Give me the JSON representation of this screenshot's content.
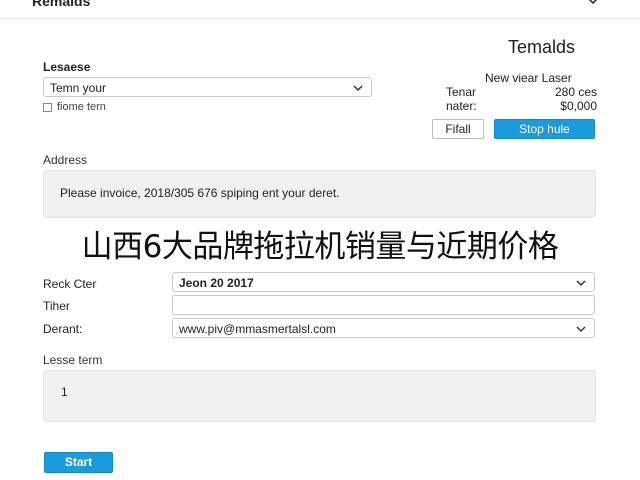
{
  "header": {
    "title": "Remalds"
  },
  "panel_title": "Temalds",
  "lease": {
    "label": "Lesaese",
    "select_value": "Temn your",
    "checkbox_label": "fiome tern"
  },
  "summary": {
    "heading": "New viear Laser",
    "rows": [
      {
        "key": "Tenar",
        "value": "280 ces"
      },
      {
        "key": "nater:",
        "value": "$0,000"
      }
    ],
    "fill_button": "Fifall",
    "stop_button": "Stop hule"
  },
  "address": {
    "label": "Address",
    "text": "Please invoice, 2018/305 676 spiping ent your deret."
  },
  "overlay_text": "山西6大品牌拖拉机销量与近期价格",
  "fields": [
    {
      "label": "Reck Cter",
      "value": "Jeon 20 2017"
    },
    {
      "label": "Tiher",
      "value": ""
    },
    {
      "label": "Derant:",
      "value": "www.piv@mmasmertalsl.com"
    }
  ],
  "lease_term": {
    "label": "Lesse term",
    "value": "1"
  },
  "start_button": "Start",
  "colors": {
    "primary": "#1a9bdc",
    "panel_bg": "#f0f0f0"
  },
  "icons": {
    "dropdown": "chevron-down-icon"
  }
}
